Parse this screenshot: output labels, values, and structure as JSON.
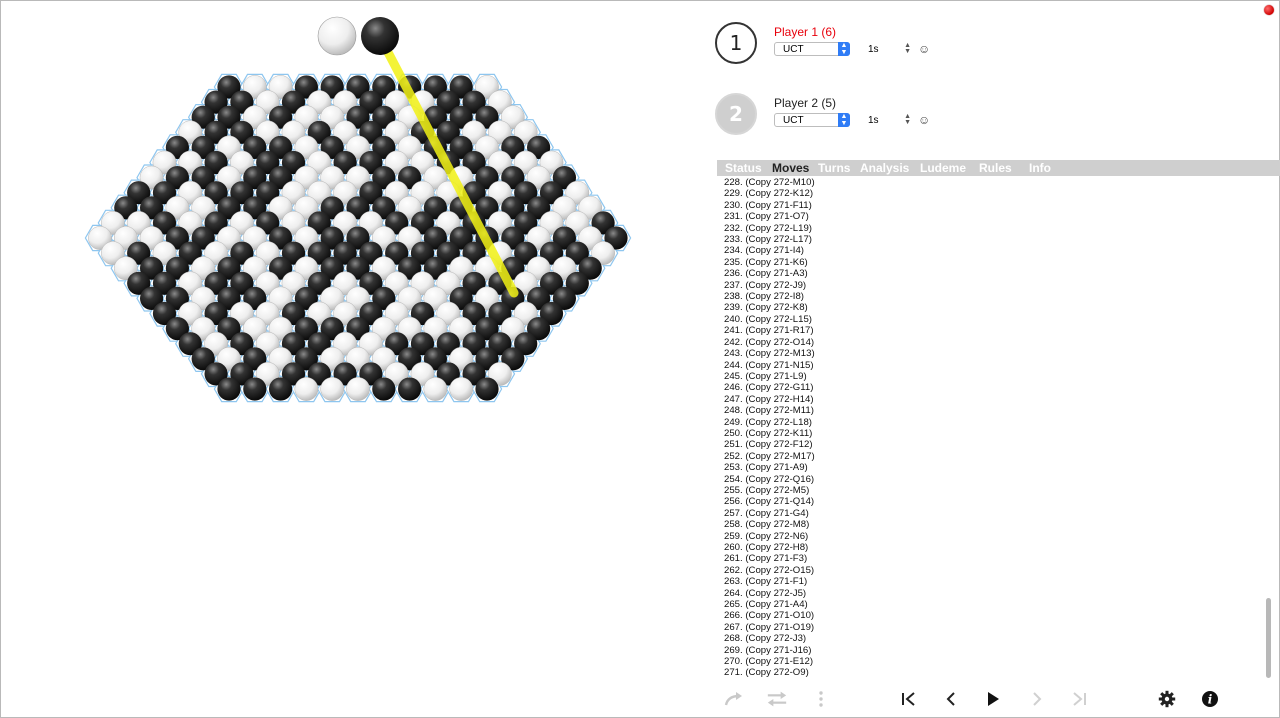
{
  "window": {
    "close_color": "#d10000"
  },
  "board": {
    "piece_colors": {
      "black": "#141414",
      "white": "#f4f4f4"
    },
    "cell_border_color": "#8ec6ef",
    "last_move_line_color": "#f2f215",
    "row_lengths": [
      11,
      12,
      13,
      14,
      15,
      16,
      17,
      18,
      19,
      20,
      21,
      20,
      19,
      18,
      17,
      16,
      15,
      14,
      13,
      12,
      11
    ],
    "rows": [
      "BWWBBBBBBBW",
      "BBWBWWBWWBBW",
      "BBWBWWBBWBBBW",
      "WBBWWBWBWBBWWW",
      "BBWBBWBWBWBBWBB",
      "WWBWBBWBBWWBBWWW",
      "WBBWBBWWWBBWWBBWB",
      "BBWBBBWWWBWWWBWBBW",
      "BBWWBBWWBBBWBBBBBWW",
      "WWBWBWBWBWWBBWBWBWWB",
      "WWWBBWWBWBBWWBBBBWBWB",
      "WBWBWBWBBBBBBBBWBBBW",
      "WBBWBWBWBBWBBWWBWWB",
      "BBWBBWWBWBWWWBBWBB",
      "BBWBBWBWWBWWBWBBB",
      "BWBWWBWWBWBWBBWB",
      "BWBWWBBBWWWWBWB",
      "BWBWBBWWBBBBBB",
      "BWBWBWWWBBWBB",
      "BBWBBBBWWBBW",
      "BBBWWWBBWWB"
    ],
    "last_move": {
      "from_piece": "black",
      "to_cell": "M10"
    }
  },
  "indicators": {
    "white": "white-stone",
    "black": "black-stone"
  },
  "players": [
    {
      "badge": "1",
      "name": "Player 1  (6)",
      "ai": "UCT",
      "time": "1s",
      "active": true
    },
    {
      "badge": "2",
      "name": "Player 2  (5)",
      "ai": "UCT",
      "time": "1s",
      "active": false
    }
  ],
  "tabs": [
    "Status",
    "Moves",
    "Turns",
    "Analysis",
    "Ludeme",
    "Rules",
    "Info"
  ],
  "active_tab": "Moves",
  "moves": [
    "228. (Copy 272-M10)",
    "229. (Copy 272-K12)",
    "230. (Copy 271-F11)",
    "231. (Copy 271-O7)",
    "232. (Copy 272-L19)",
    "233. (Copy 272-L17)",
    "234. (Copy 271-I4)",
    "235. (Copy 271-K6)",
    "236. (Copy 271-A3)",
    "237. (Copy 272-J9)",
    "238. (Copy 272-I8)",
    "239. (Copy 272-K8)",
    "240. (Copy 272-L15)",
    "241. (Copy 271-R17)",
    "242. (Copy 272-O14)",
    "243. (Copy 272-M13)",
    "244. (Copy 271-N15)",
    "245. (Copy 271-L9)",
    "246. (Copy 272-G11)",
    "247. (Copy 272-H14)",
    "248. (Copy 272-M11)",
    "249. (Copy 272-L18)",
    "250. (Copy 272-K11)",
    "251. (Copy 272-F12)",
    "252. (Copy 272-M17)",
    "253. (Copy 271-A9)",
    "254. (Copy 272-Q16)",
    "255. (Copy 272-M5)",
    "256. (Copy 271-Q14)",
    "257. (Copy 271-G4)",
    "258. (Copy 272-M8)",
    "259. (Copy 272-N6)",
    "260. (Copy 272-H8)",
    "261. (Copy 271-F3)",
    "262. (Copy 272-O15)",
    "263. (Copy 271-F1)",
    "264. (Copy 272-J5)",
    "265. (Copy 271-A4)",
    "266. (Copy 271-O10)",
    "267. (Copy 271-O19)",
    "268. (Copy 272-J3)",
    "269. (Copy 271-J16)",
    "270. (Copy 271-E12)",
    "271. (Copy 272-O9)"
  ],
  "controls": {
    "left": [
      "redo-icon",
      "swap-icon",
      "more-icon"
    ],
    "nav": [
      "first-icon",
      "prev-icon",
      "play-icon",
      "next-icon",
      "last-icon"
    ],
    "right": [
      "settings-icon",
      "info-icon"
    ]
  }
}
